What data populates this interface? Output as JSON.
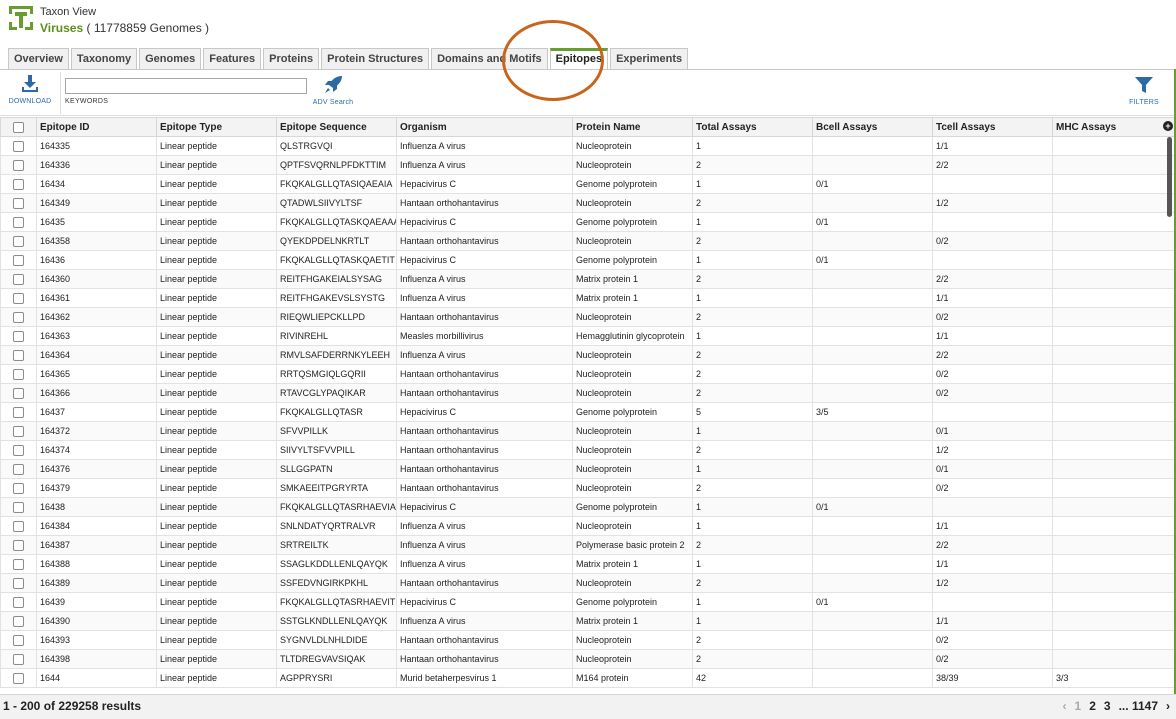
{
  "header": {
    "view_label": "Taxon View",
    "taxon_name": "Viruses",
    "genome_count": "( 11778859 Genomes )"
  },
  "tabs": [
    {
      "label": "Overview"
    },
    {
      "label": "Taxonomy"
    },
    {
      "label": "Genomes"
    },
    {
      "label": "Features"
    },
    {
      "label": "Proteins"
    },
    {
      "label": "Protein Structures"
    },
    {
      "label": "Domains and Motifs"
    },
    {
      "label": "Epitopes",
      "active": true
    },
    {
      "label": "Experiments"
    }
  ],
  "toolbar": {
    "download_label": "DOWNLOAD",
    "keywords_label": "KEYWORDS",
    "keywords_value": "",
    "adv_search_label": "ADV Search",
    "filters_label": "FILTERS"
  },
  "columns": [
    "Epitope ID",
    "Epitope Type",
    "Epitope Sequence",
    "Organism",
    "Protein Name",
    "Total Assays",
    "Bcell Assays",
    "Tcell Assays",
    "MHC Assays"
  ],
  "rows": [
    [
      "164335",
      "Linear peptide",
      "QLSTRGVQI",
      "Influenza A virus",
      "Nucleoprotein",
      "1",
      "",
      "1/1",
      ""
    ],
    [
      "164336",
      "Linear peptide",
      "QPTFSVQRNLPFDKTTIM",
      "Influenza A virus",
      "Nucleoprotein",
      "2",
      "",
      "2/2",
      ""
    ],
    [
      "16434",
      "Linear peptide",
      "FKQKALGLLQTASIQAEAIA",
      "Hepacivirus C",
      "Genome polyprotein",
      "1",
      "0/1",
      "",
      ""
    ],
    [
      "164349",
      "Linear peptide",
      "QTADWLSIIVYLTSF",
      "Hantaan orthohantavirus",
      "Nucleoprotein",
      "2",
      "",
      "1/2",
      ""
    ],
    [
      "16435",
      "Linear peptide",
      "FKQKALGLLQTASKQAEAAA",
      "Hepacivirus C",
      "Genome polyprotein",
      "1",
      "0/1",
      "",
      ""
    ],
    [
      "164358",
      "Linear peptide",
      "QYEKDPDELNKRTLT",
      "Hantaan orthohantavirus",
      "Nucleoprotein",
      "2",
      "",
      "0/2",
      ""
    ],
    [
      "16436",
      "Linear peptide",
      "FKQKALGLLQTASKQAETIT",
      "Hepacivirus C",
      "Genome polyprotein",
      "1",
      "0/1",
      "",
      ""
    ],
    [
      "164360",
      "Linear peptide",
      "REITFHGAKEIALSYSAG",
      "Influenza A virus",
      "Matrix protein 1",
      "2",
      "",
      "2/2",
      ""
    ],
    [
      "164361",
      "Linear peptide",
      "REITFHGAKEVSLSYSTG",
      "Influenza A virus",
      "Matrix protein 1",
      "1",
      "",
      "1/1",
      ""
    ],
    [
      "164362",
      "Linear peptide",
      "RIEQWLIEPCKLLPD",
      "Hantaan orthohantavirus",
      "Nucleoprotein",
      "2",
      "",
      "0/2",
      ""
    ],
    [
      "164363",
      "Linear peptide",
      "RIVINREHL",
      "Measles morbillivirus",
      "Hemagglutinin glycoprotein",
      "1",
      "",
      "1/1",
      ""
    ],
    [
      "164364",
      "Linear peptide",
      "RMVLSAFDERRNKYLEEH",
      "Influenza A virus",
      "Nucleoprotein",
      "2",
      "",
      "2/2",
      ""
    ],
    [
      "164365",
      "Linear peptide",
      "RRTQSMGIQLGQRII",
      "Hantaan orthohantavirus",
      "Nucleoprotein",
      "2",
      "",
      "0/2",
      ""
    ],
    [
      "164366",
      "Linear peptide",
      "RTAVCGLYPAQIKAR",
      "Hantaan orthohantavirus",
      "Nucleoprotein",
      "2",
      "",
      "0/2",
      ""
    ],
    [
      "16437",
      "Linear peptide",
      "FKQKALGLLQTASR",
      "Hepacivirus C",
      "Genome polyprotein",
      "5",
      "3/5",
      "",
      ""
    ],
    [
      "164372",
      "Linear peptide",
      "SFVVPILLK",
      "Hantaan orthohantavirus",
      "Nucleoprotein",
      "1",
      "",
      "0/1",
      ""
    ],
    [
      "164374",
      "Linear peptide",
      "SIIVYLTSFVVPILL",
      "Hantaan orthohantavirus",
      "Nucleoprotein",
      "2",
      "",
      "1/2",
      ""
    ],
    [
      "164376",
      "Linear peptide",
      "SLLGGPATN",
      "Hantaan orthohantavirus",
      "Nucleoprotein",
      "1",
      "",
      "0/1",
      ""
    ],
    [
      "164379",
      "Linear peptide",
      "SMKAEEITPGRYRTA",
      "Hantaan orthohantavirus",
      "Nucleoprotein",
      "2",
      "",
      "0/2",
      ""
    ],
    [
      "16438",
      "Linear peptide",
      "FKQKALGLLQTASRHAEVIA",
      "Hepacivirus C",
      "Genome polyprotein",
      "1",
      "0/1",
      "",
      ""
    ],
    [
      "164384",
      "Linear peptide",
      "SNLNDATYQRTRALVR",
      "Influenza A virus",
      "Nucleoprotein",
      "1",
      "",
      "1/1",
      ""
    ],
    [
      "164387",
      "Linear peptide",
      "SRTREILTK",
      "Influenza A virus",
      "Polymerase basic protein 2",
      "2",
      "",
      "2/2",
      ""
    ],
    [
      "164388",
      "Linear peptide",
      "SSAGLKDDLLENLQAYQK",
      "Influenza A virus",
      "Matrix protein 1",
      "1",
      "",
      "1/1",
      ""
    ],
    [
      "164389",
      "Linear peptide",
      "SSFEDVNGIRKPKHL",
      "Hantaan orthohantavirus",
      "Nucleoprotein",
      "2",
      "",
      "1/2",
      ""
    ],
    [
      "16439",
      "Linear peptide",
      "FKQKALGLLQTASRHAEVIT",
      "Hepacivirus C",
      "Genome polyprotein",
      "1",
      "0/1",
      "",
      ""
    ],
    [
      "164390",
      "Linear peptide",
      "SSTGLKNDLLENLQAYQK",
      "Influenza A virus",
      "Matrix protein 1",
      "1",
      "",
      "1/1",
      ""
    ],
    [
      "164393",
      "Linear peptide",
      "SYGNVLDLNHLDIDE",
      "Hantaan orthohantavirus",
      "Nucleoprotein",
      "2",
      "",
      "0/2",
      ""
    ],
    [
      "164398",
      "Linear peptide",
      "TLTDREGVAVSIQAK",
      "Hantaan orthohantavirus",
      "Nucleoprotein",
      "2",
      "",
      "0/2",
      ""
    ],
    [
      "1644",
      "Linear peptide",
      "AGPPRYSRI",
      "Murid betaherpesvirus 1",
      "M164 protein",
      "42",
      "",
      "38/39",
      "3/3"
    ]
  ],
  "footer": {
    "results_text": "1 - 200 of 229258 results",
    "pager": {
      "prev": "‹",
      "current": "1",
      "p2": "2",
      "p3": "3",
      "ellipsis": "...",
      "last": "1147",
      "next": "›"
    }
  },
  "colors": {
    "accent_green": "#6a9d2f",
    "link_blue": "#2c6aa6",
    "annotation_orange": "#c8651b"
  },
  "icons": {
    "logo": "taxon-logo-icon",
    "download": "download-icon",
    "adv_search": "rocket-icon",
    "filters": "funnel-icon",
    "add_column": "plus-circle-icon"
  }
}
